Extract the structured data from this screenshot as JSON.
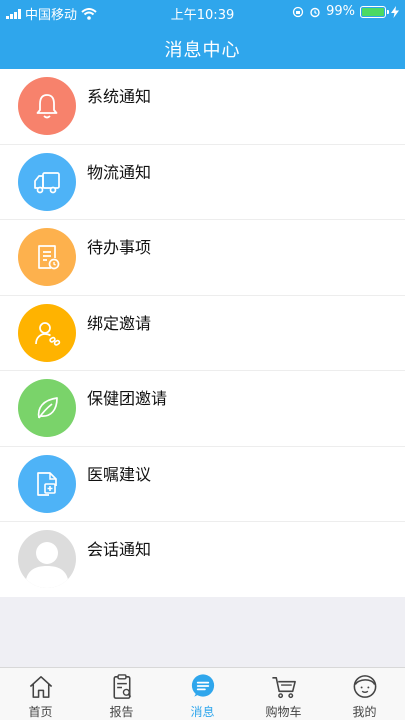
{
  "status_bar": {
    "carrier": "中国移动",
    "time": "上午10:39",
    "battery_percent": "99%",
    "battery_level": 0.99,
    "icons": [
      "signal-icon",
      "wifi-icon",
      "orientation-lock-icon",
      "alarm-icon",
      "battery-icon",
      "charging-icon"
    ]
  },
  "header": {
    "title": "消息中心"
  },
  "colors": {
    "brand": "#2fa6ec",
    "bell": "#f7826c",
    "truck": "#4eb3f7",
    "todo": "#fdb14d",
    "invite": "#ffb300",
    "leaf": "#7ad36a",
    "advice": "#4eb3f7",
    "chat": "#dcdcdc"
  },
  "messages": [
    {
      "label": "系统通知",
      "icon": "bell-icon"
    },
    {
      "label": "物流通知",
      "icon": "truck-icon"
    },
    {
      "label": "待办事项",
      "icon": "todo-document-icon"
    },
    {
      "label": "绑定邀请",
      "icon": "user-link-icon"
    },
    {
      "label": "保健团邀请",
      "icon": "leaf-icon"
    },
    {
      "label": "医嘱建议",
      "icon": "medical-document-icon"
    },
    {
      "label": "会话通知",
      "icon": "default-avatar-icon"
    }
  ],
  "tabbar": {
    "tabs": [
      {
        "label": "首页",
        "icon": "home-icon"
      },
      {
        "label": "报告",
        "icon": "report-icon"
      },
      {
        "label": "消息",
        "icon": "message-icon",
        "active": true
      },
      {
        "label": "购物车",
        "icon": "cart-icon"
      },
      {
        "label": "我的",
        "icon": "profile-icon"
      }
    ]
  }
}
